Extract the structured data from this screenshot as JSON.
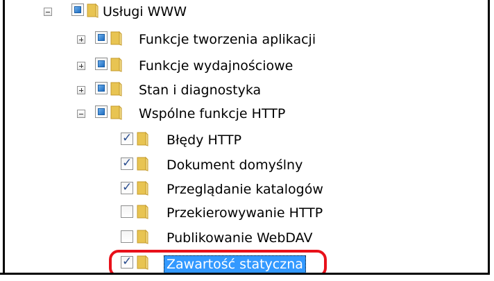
{
  "tree": {
    "root": {
      "label": "Usługi WWW",
      "expander": "minus",
      "check": "partial"
    },
    "children": [
      {
        "label": "Funkcje tworzenia aplikacji",
        "expander": "plus",
        "check": "partial"
      },
      {
        "label": "Funkcje wydajnościowe",
        "expander": "plus",
        "check": "partial"
      },
      {
        "label": "Stan i diagnostyka",
        "expander": "plus",
        "check": "partial"
      },
      {
        "label": "Wspólne funkcje HTTP",
        "expander": "minus",
        "check": "partial"
      }
    ],
    "http_items": [
      {
        "label": "Błędy HTTP",
        "check": "checked"
      },
      {
        "label": "Dokument domyślny",
        "check": "checked"
      },
      {
        "label": "Przeglądanie katalogów",
        "check": "checked"
      },
      {
        "label": "Przekierowywanie HTTP",
        "check": "unchecked"
      },
      {
        "label": "Publikowanie WebDAV",
        "check": "unchecked"
      },
      {
        "label": "Zawartość statyczna",
        "check": "checked",
        "selected": true
      }
    ]
  },
  "colors": {
    "highlight": "#e8111a",
    "selection": "#3399ff",
    "folder": "#e8c452"
  },
  "icons": {
    "folder": "folder-icon",
    "expand": "plus-icon",
    "collapse": "minus-icon"
  }
}
